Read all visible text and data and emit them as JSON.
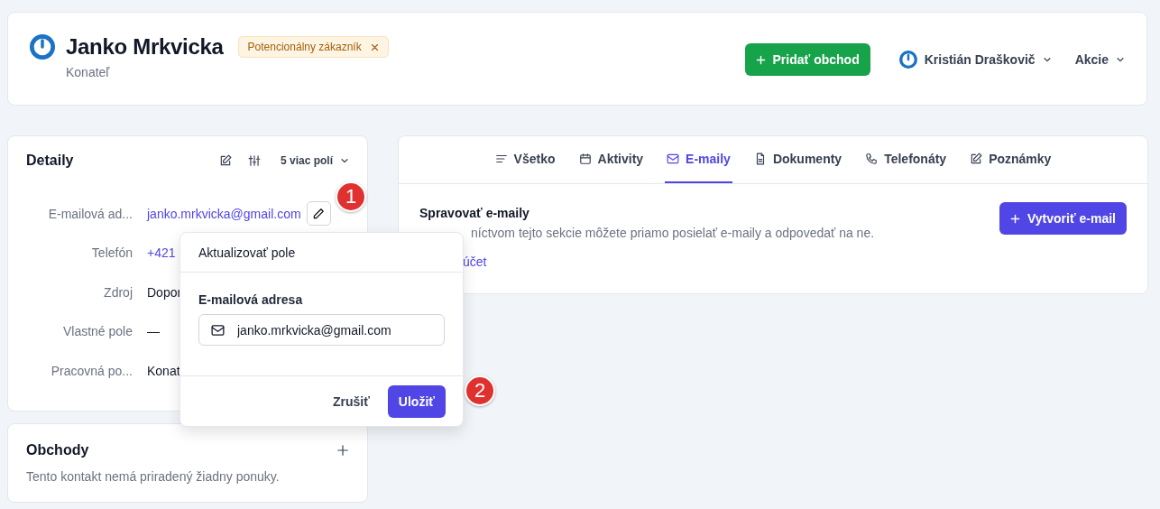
{
  "header": {
    "name": "Janko Mrkvicka",
    "role": "Konateľ",
    "tag": {
      "label": "Potencionálny zákazník",
      "removable": true
    },
    "add_button": "Pridať obchod",
    "owner": "Kristián Draškovič",
    "actions": "Akcie"
  },
  "details": {
    "title": "Detaily",
    "more_fields": "5 viac polí",
    "fields": [
      {
        "label": "E-mailová ad...",
        "value": "janko.mrkvicka@gmail.com",
        "kind": "link",
        "editing": true
      },
      {
        "label": "Telefón",
        "value": "+421",
        "kind": "link",
        "editing": false
      },
      {
        "label": "Zdroj",
        "value": "Dopor",
        "kind": "text",
        "editing": false
      },
      {
        "label": "Vlastné pole",
        "value": "—",
        "kind": "text",
        "editing": false
      },
      {
        "label": "Pracovná po...",
        "value": "Konat",
        "kind": "text",
        "editing": false
      }
    ]
  },
  "deals": {
    "title": "Obchody",
    "empty_text": "Tento kontakt nemá priradený žiadny ponuky."
  },
  "tabs": [
    {
      "label": "Všetko",
      "selected": false
    },
    {
      "label": "Aktivity",
      "selected": false
    },
    {
      "label": "E-maily",
      "selected": true
    },
    {
      "label": "Dokumenty",
      "selected": false
    },
    {
      "label": "Telefonáty",
      "selected": false
    },
    {
      "label": "Poznámky",
      "selected": false
    }
  ],
  "emails": {
    "title": "Spravovať e-maily",
    "description": "níctvom tejto sekcie môžete priamo posielať e-maily a odpovedať na ne.",
    "link": "účet",
    "create_button": "Vytvoriť e-mail"
  },
  "popover": {
    "title": "Aktualizovať pole",
    "field_label": "E-mailová adresa",
    "value": "janko.mrkvicka@gmail.com",
    "cancel": "Zrušiť",
    "save": "Uložiť"
  },
  "markers": [
    {
      "label": "1"
    },
    {
      "label": "2"
    }
  ]
}
